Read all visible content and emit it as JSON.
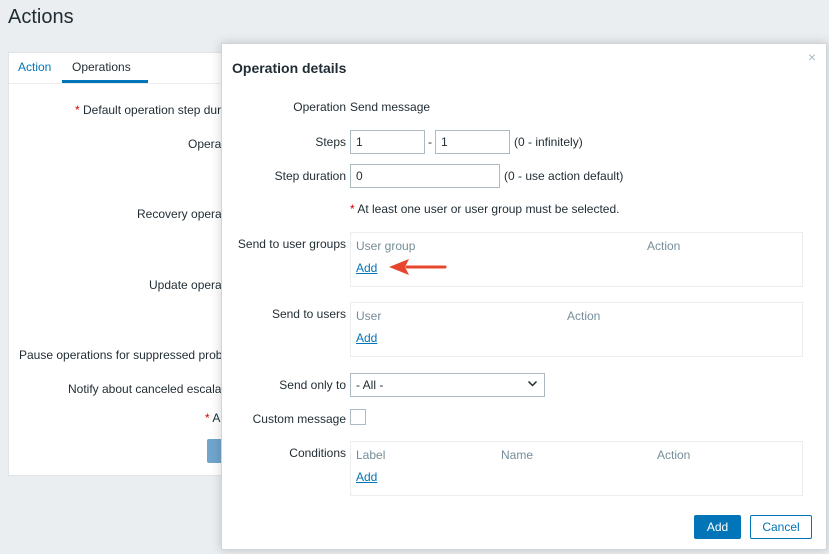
{
  "page": {
    "title": "Actions"
  },
  "background": {
    "tabs": [
      {
        "label": "Action"
      },
      {
        "label": "Operations"
      }
    ],
    "labels": {
      "default_duration": "Default operation step dur",
      "operations": "Opera",
      "recovery": "Recovery opera",
      "update": "Update opera",
      "pause": "Pause operations for suppressed prob",
      "notify": "Notify about canceled escala",
      "a_field": "A",
      "required_mark": "*"
    }
  },
  "modal": {
    "title": "Operation details",
    "close_icon": "×",
    "operation": {
      "label": "Operation",
      "value": "Send message"
    },
    "steps": {
      "label": "Steps",
      "from": "1",
      "separator": "-",
      "to": "1",
      "hint": "(0 - infinitely)"
    },
    "step_duration": {
      "label": "Step duration",
      "value": "0",
      "hint": "(0 - use action default)"
    },
    "warning": {
      "mark": "*",
      "text": " At least one user or user group must be selected."
    },
    "user_groups": {
      "label": "Send to user groups",
      "col1": "User group",
      "col2": "Action",
      "add": "Add"
    },
    "users": {
      "label": "Send to users",
      "col1": "User",
      "col2": "Action",
      "add": "Add"
    },
    "send_only_to": {
      "label": "Send only to",
      "selected": "- All -"
    },
    "custom_message": {
      "label": "Custom message"
    },
    "conditions": {
      "label": "Conditions",
      "col1": "Label",
      "col2": "Name",
      "col3": "Action",
      "add": "Add"
    },
    "buttons": {
      "add": "Add",
      "cancel": "Cancel"
    }
  },
  "colors": {
    "accent": "#0275b8",
    "annotation_arrow": "#e8462c",
    "required": "#d40000"
  }
}
